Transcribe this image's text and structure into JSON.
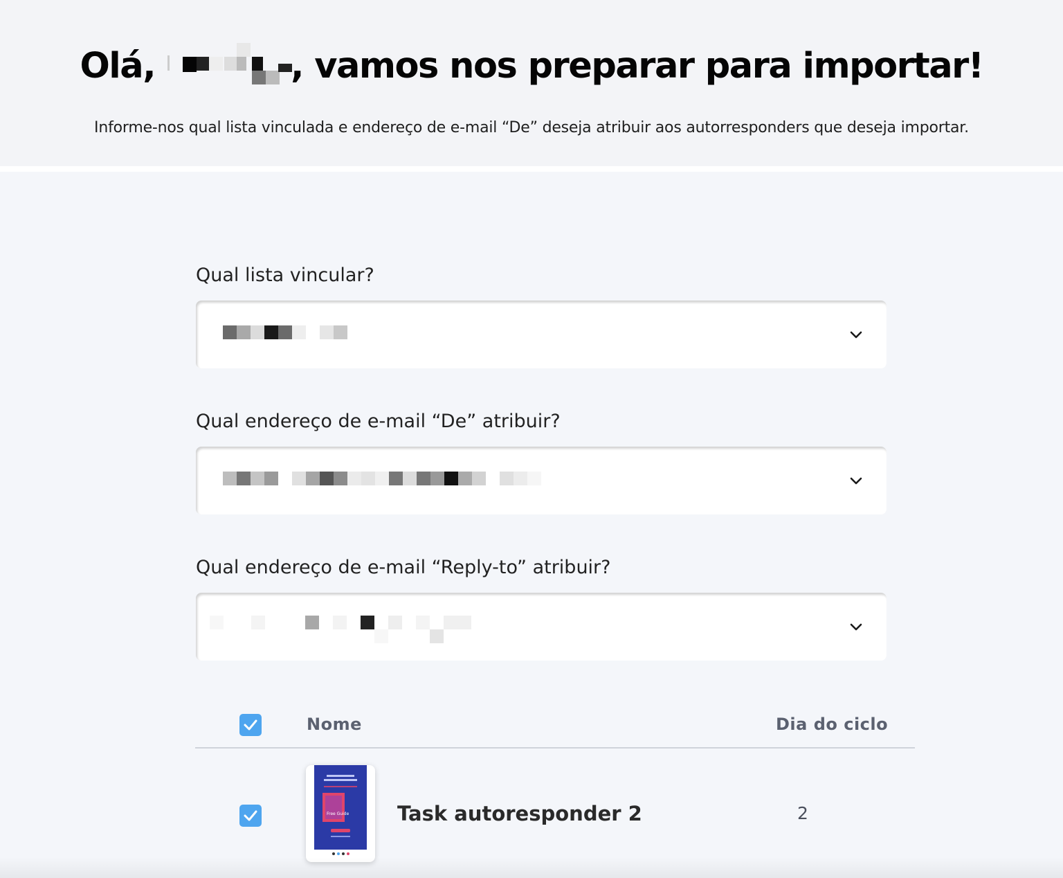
{
  "header": {
    "greeting_prefix": "Olá,",
    "greeting_suffix": ", vamos nos preparar para importar!",
    "subtitle": "Informe-nos qual lista vinculada e endereço de e-mail “De” deseja atribuir aos autorresponders que deseja importar."
  },
  "form": {
    "list_label": "Qual lista vincular?",
    "from_label": "Qual endereço de e-mail “De” atribuir?",
    "reply_label": "Qual endereço de e-mail “Reply-to” atribuir?"
  },
  "table": {
    "header_name": "Nome",
    "header_day": "Dia do ciclo",
    "rows": [
      {
        "name": "Task autoresponder 2",
        "day": "2",
        "checked": true,
        "thumb": {
          "headline": "You've made it. Here's how to...",
          "cover_text": "Free Guide"
        }
      }
    ],
    "select_all_checked": true
  },
  "colors": {
    "accent": "#4ea5ef",
    "thumb_bg": "#2b3aa6",
    "thumb_cover": "#e0456b"
  },
  "icons": {
    "select_chevron": "chevron-down-icon",
    "checkbox": "check-icon"
  }
}
